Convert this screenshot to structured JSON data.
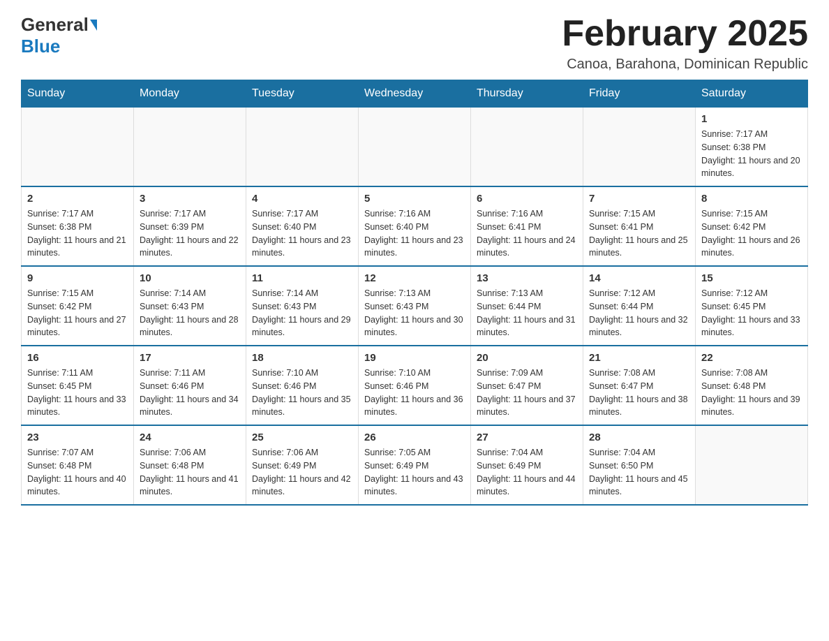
{
  "logo": {
    "general": "General",
    "blue": "Blue"
  },
  "header": {
    "title": "February 2025",
    "location": "Canoa, Barahona, Dominican Republic"
  },
  "weekdays": [
    "Sunday",
    "Monday",
    "Tuesday",
    "Wednesday",
    "Thursday",
    "Friday",
    "Saturday"
  ],
  "weeks": [
    [
      {
        "day": "",
        "sunrise": "",
        "sunset": "",
        "daylight": ""
      },
      {
        "day": "",
        "sunrise": "",
        "sunset": "",
        "daylight": ""
      },
      {
        "day": "",
        "sunrise": "",
        "sunset": "",
        "daylight": ""
      },
      {
        "day": "",
        "sunrise": "",
        "sunset": "",
        "daylight": ""
      },
      {
        "day": "",
        "sunrise": "",
        "sunset": "",
        "daylight": ""
      },
      {
        "day": "",
        "sunrise": "",
        "sunset": "",
        "daylight": ""
      },
      {
        "day": "1",
        "sunrise": "Sunrise: 7:17 AM",
        "sunset": "Sunset: 6:38 PM",
        "daylight": "Daylight: 11 hours and 20 minutes."
      }
    ],
    [
      {
        "day": "2",
        "sunrise": "Sunrise: 7:17 AM",
        "sunset": "Sunset: 6:38 PM",
        "daylight": "Daylight: 11 hours and 21 minutes."
      },
      {
        "day": "3",
        "sunrise": "Sunrise: 7:17 AM",
        "sunset": "Sunset: 6:39 PM",
        "daylight": "Daylight: 11 hours and 22 minutes."
      },
      {
        "day": "4",
        "sunrise": "Sunrise: 7:17 AM",
        "sunset": "Sunset: 6:40 PM",
        "daylight": "Daylight: 11 hours and 23 minutes."
      },
      {
        "day": "5",
        "sunrise": "Sunrise: 7:16 AM",
        "sunset": "Sunset: 6:40 PM",
        "daylight": "Daylight: 11 hours and 23 minutes."
      },
      {
        "day": "6",
        "sunrise": "Sunrise: 7:16 AM",
        "sunset": "Sunset: 6:41 PM",
        "daylight": "Daylight: 11 hours and 24 minutes."
      },
      {
        "day": "7",
        "sunrise": "Sunrise: 7:15 AM",
        "sunset": "Sunset: 6:41 PM",
        "daylight": "Daylight: 11 hours and 25 minutes."
      },
      {
        "day": "8",
        "sunrise": "Sunrise: 7:15 AM",
        "sunset": "Sunset: 6:42 PM",
        "daylight": "Daylight: 11 hours and 26 minutes."
      }
    ],
    [
      {
        "day": "9",
        "sunrise": "Sunrise: 7:15 AM",
        "sunset": "Sunset: 6:42 PM",
        "daylight": "Daylight: 11 hours and 27 minutes."
      },
      {
        "day": "10",
        "sunrise": "Sunrise: 7:14 AM",
        "sunset": "Sunset: 6:43 PM",
        "daylight": "Daylight: 11 hours and 28 minutes."
      },
      {
        "day": "11",
        "sunrise": "Sunrise: 7:14 AM",
        "sunset": "Sunset: 6:43 PM",
        "daylight": "Daylight: 11 hours and 29 minutes."
      },
      {
        "day": "12",
        "sunrise": "Sunrise: 7:13 AM",
        "sunset": "Sunset: 6:43 PM",
        "daylight": "Daylight: 11 hours and 30 minutes."
      },
      {
        "day": "13",
        "sunrise": "Sunrise: 7:13 AM",
        "sunset": "Sunset: 6:44 PM",
        "daylight": "Daylight: 11 hours and 31 minutes."
      },
      {
        "day": "14",
        "sunrise": "Sunrise: 7:12 AM",
        "sunset": "Sunset: 6:44 PM",
        "daylight": "Daylight: 11 hours and 32 minutes."
      },
      {
        "day": "15",
        "sunrise": "Sunrise: 7:12 AM",
        "sunset": "Sunset: 6:45 PM",
        "daylight": "Daylight: 11 hours and 33 minutes."
      }
    ],
    [
      {
        "day": "16",
        "sunrise": "Sunrise: 7:11 AM",
        "sunset": "Sunset: 6:45 PM",
        "daylight": "Daylight: 11 hours and 33 minutes."
      },
      {
        "day": "17",
        "sunrise": "Sunrise: 7:11 AM",
        "sunset": "Sunset: 6:46 PM",
        "daylight": "Daylight: 11 hours and 34 minutes."
      },
      {
        "day": "18",
        "sunrise": "Sunrise: 7:10 AM",
        "sunset": "Sunset: 6:46 PM",
        "daylight": "Daylight: 11 hours and 35 minutes."
      },
      {
        "day": "19",
        "sunrise": "Sunrise: 7:10 AM",
        "sunset": "Sunset: 6:46 PM",
        "daylight": "Daylight: 11 hours and 36 minutes."
      },
      {
        "day": "20",
        "sunrise": "Sunrise: 7:09 AM",
        "sunset": "Sunset: 6:47 PM",
        "daylight": "Daylight: 11 hours and 37 minutes."
      },
      {
        "day": "21",
        "sunrise": "Sunrise: 7:08 AM",
        "sunset": "Sunset: 6:47 PM",
        "daylight": "Daylight: 11 hours and 38 minutes."
      },
      {
        "day": "22",
        "sunrise": "Sunrise: 7:08 AM",
        "sunset": "Sunset: 6:48 PM",
        "daylight": "Daylight: 11 hours and 39 minutes."
      }
    ],
    [
      {
        "day": "23",
        "sunrise": "Sunrise: 7:07 AM",
        "sunset": "Sunset: 6:48 PM",
        "daylight": "Daylight: 11 hours and 40 minutes."
      },
      {
        "day": "24",
        "sunrise": "Sunrise: 7:06 AM",
        "sunset": "Sunset: 6:48 PM",
        "daylight": "Daylight: 11 hours and 41 minutes."
      },
      {
        "day": "25",
        "sunrise": "Sunrise: 7:06 AM",
        "sunset": "Sunset: 6:49 PM",
        "daylight": "Daylight: 11 hours and 42 minutes."
      },
      {
        "day": "26",
        "sunrise": "Sunrise: 7:05 AM",
        "sunset": "Sunset: 6:49 PM",
        "daylight": "Daylight: 11 hours and 43 minutes."
      },
      {
        "day": "27",
        "sunrise": "Sunrise: 7:04 AM",
        "sunset": "Sunset: 6:49 PM",
        "daylight": "Daylight: 11 hours and 44 minutes."
      },
      {
        "day": "28",
        "sunrise": "Sunrise: 7:04 AM",
        "sunset": "Sunset: 6:50 PM",
        "daylight": "Daylight: 11 hours and 45 minutes."
      },
      {
        "day": "",
        "sunrise": "",
        "sunset": "",
        "daylight": ""
      }
    ]
  ]
}
